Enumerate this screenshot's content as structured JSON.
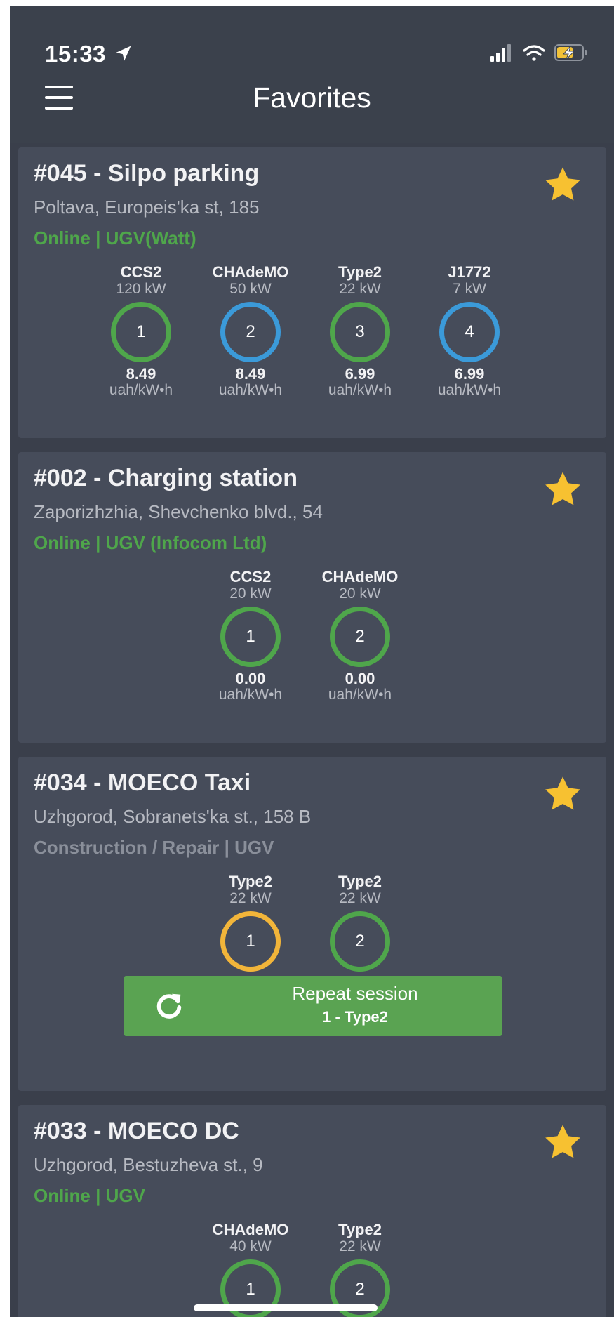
{
  "status_bar": {
    "time": "15:33"
  },
  "header": {
    "title": "Favorites"
  },
  "colors": {
    "online": "#4fa64b",
    "repair": "#8a8f9a",
    "ring_green": "#4fa64b",
    "ring_blue": "#3b9ad9",
    "ring_yellow": "#f2b53a",
    "star": "#f7c131",
    "button_green": "#5aa352"
  },
  "stations": [
    {
      "title": "#045 - Silpo parking",
      "address": "Poltava, Europeis'ka st, 185",
      "status": "Online | UGV(Watt)",
      "status_color": "#4fa64b",
      "connectors": [
        {
          "type": "CCS2",
          "power": "120 kW",
          "number": "1",
          "ring": "green",
          "price": "8.49",
          "unit": "uah/kW•h"
        },
        {
          "type": "CHAdeMO",
          "power": "50 kW",
          "number": "2",
          "ring": "blue",
          "price": "8.49",
          "unit": "uah/kW•h"
        },
        {
          "type": "Type2",
          "power": "22 kW",
          "number": "3",
          "ring": "green",
          "price": "6.99",
          "unit": "uah/kW•h"
        },
        {
          "type": "J1772",
          "power": "7 kW",
          "number": "4",
          "ring": "blue",
          "price": "6.99",
          "unit": "uah/kW•h"
        }
      ]
    },
    {
      "title": "#002 - Charging station",
      "address": "Zaporizhzhia, Shevchenko blvd., 54",
      "status": "Online | UGV (Infocom Ltd)",
      "status_color": "#4fa64b",
      "connectors": [
        {
          "type": "CCS2",
          "power": "20 kW",
          "number": "1",
          "ring": "green",
          "price": "0.00",
          "unit": "uah/kW•h"
        },
        {
          "type": "CHAdeMO",
          "power": "20 kW",
          "number": "2",
          "ring": "green",
          "price": "0.00",
          "unit": "uah/kW•h"
        }
      ]
    },
    {
      "title": "#034 - MOECO Taxi",
      "address": "Uzhgorod, Sobranets'ka st., 158 B",
      "status": "Construction / Repair | UGV",
      "status_color": "#8a8f9a",
      "connectors": [
        {
          "type": "Type2",
          "power": "22 kW",
          "number": "1",
          "ring": "yellow"
        },
        {
          "type": "Type2",
          "power": "22 kW",
          "number": "2",
          "ring": "green"
        }
      ],
      "repeat_button": {
        "label": "Repeat session",
        "sub": "1 - Type2"
      }
    },
    {
      "title": "#033 - MOECO DC",
      "address": "Uzhgorod, Bestuzheva st., 9",
      "status": "Online | UGV",
      "status_color": "#4fa64b",
      "connectors": [
        {
          "type": "CHAdeMO",
          "power": "40 kW",
          "number": "1",
          "ring": "green"
        },
        {
          "type": "Type2",
          "power": "22 kW",
          "number": "2",
          "ring": "green"
        }
      ]
    }
  ]
}
